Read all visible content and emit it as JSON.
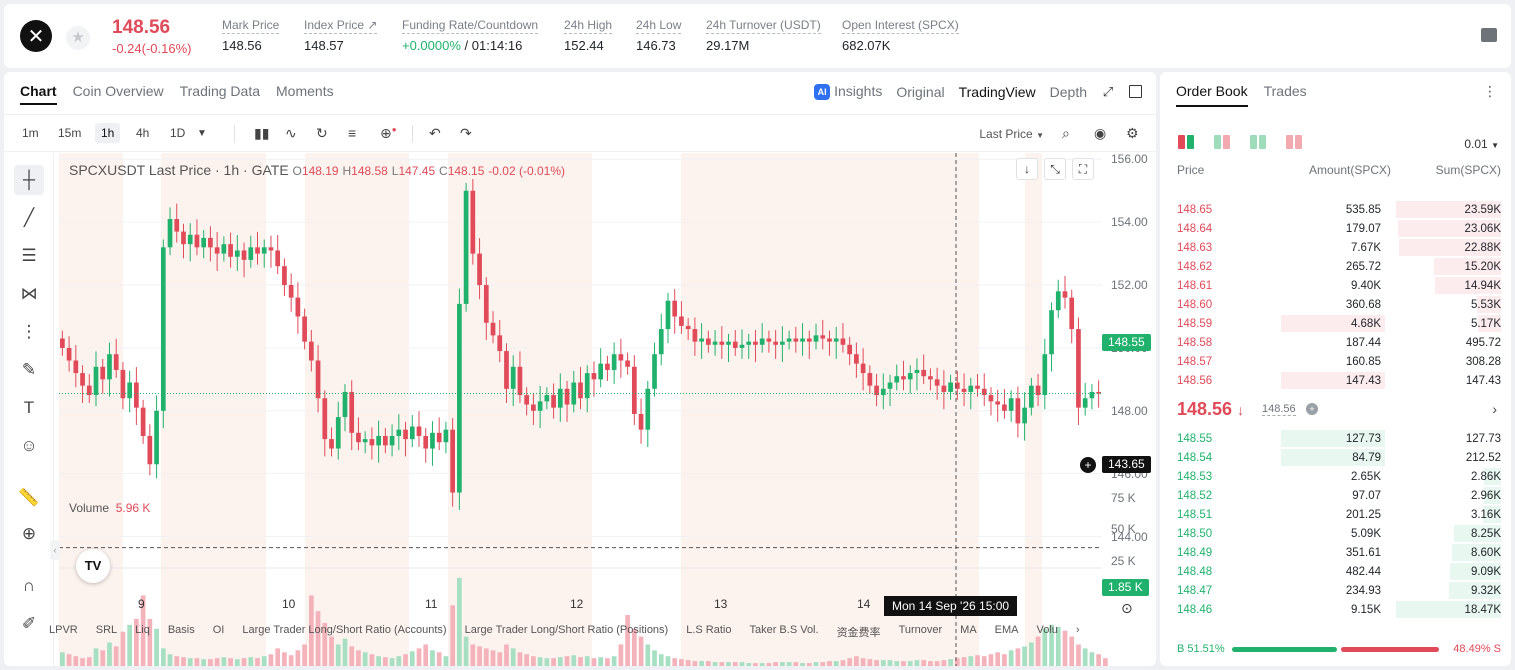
{
  "header": {
    "price": "148.56",
    "change": "-0.24(-0.16%)",
    "stats": [
      {
        "label": "Mark Price",
        "value": "148.56"
      },
      {
        "label": "Index Price ↗",
        "value": "148.57"
      },
      {
        "label": "Funding Rate/Countdown",
        "value_green": "+0.0000%",
        "value": " / 01:14:16"
      },
      {
        "label": "24h High",
        "value": "152.44"
      },
      {
        "label": "24h Low",
        "value": "146.73"
      },
      {
        "label": "24h Turnover (USDT)",
        "value": "29.17M"
      },
      {
        "label": "Open Interest (SPCX)",
        "value": "682.07K"
      }
    ]
  },
  "chart_tabs": [
    "Chart",
    "Coin Overview",
    "Trading Data",
    "Moments"
  ],
  "view_tabs": {
    "insights": "Insights",
    "original": "Original",
    "tradingview": "TradingView",
    "depth": "Depth"
  },
  "intervals": [
    "1m",
    "15m",
    "1h",
    "4h",
    "1D"
  ],
  "last_price_label": "Last Price",
  "legend": {
    "symbol": "SPCXUSDT Last Price · 1h · GATE",
    "o_label": "O",
    "o": "148.19",
    "h_label": "H",
    "h": "148.58",
    "l_label": "L",
    "l": "147.45",
    "c_label": "C",
    "c": "148.15",
    "change": "-0.02 (-0.01%)"
  },
  "volume_legend": {
    "label": "Volume",
    "value": "5.96 K"
  },
  "price_tags": {
    "current": "148.55",
    "crosshair": "143.65"
  },
  "crosshair_time": "Mon 14 Sep '26   15:00",
  "indicator_tabs": [
    "LPVR",
    "SRL",
    "Liq",
    "Basis",
    "OI",
    "Large Trader Long/Short Ratio (Accounts)",
    "Large Trader Long/Short Ratio (Positions)",
    "L.S Ratio",
    "Taker B.S Vol.",
    "资金费率",
    "Turnover",
    "MA",
    "EMA",
    "Volu"
  ],
  "chart_data": {
    "type": "candlestick",
    "title": "SPCXUSDT Last Price · 1h · GATE",
    "y_ticks": [
      "156.00",
      "154.00",
      "152.00",
      "150.00",
      "148.00",
      "146.00",
      "144.00"
    ],
    "x_ticks": [
      "9",
      "10",
      "11",
      "12",
      "13",
      "14"
    ],
    "ylim": [
      143.0,
      156.2
    ],
    "volume_ticks": [
      "75 K",
      "50 K",
      "25 K"
    ],
    "volume_current": "1.85 K",
    "volume_ylim": [
      0,
      100
    ],
    "current_price": 148.55,
    "crosshair_price": 143.65,
    "candles_close": [
      150.0,
      149.6,
      149.2,
      148.8,
      148.5,
      149.4,
      149.0,
      149.8,
      149.3,
      148.4,
      148.9,
      148.1,
      147.2,
      146.3,
      148.0,
      153.2,
      154.1,
      153.7,
      153.3,
      153.6,
      153.2,
      153.5,
      153.2,
      153.0,
      153.3,
      152.9,
      153.1,
      152.8,
      153.2,
      153.0,
      153.2,
      153.1,
      152.6,
      152.0,
      151.6,
      151.0,
      150.2,
      149.6,
      148.4,
      147.1,
      146.8,
      147.8,
      148.6,
      147.3,
      147.0,
      147.1,
      146.9,
      147.2,
      146.9,
      147.2,
      147.4,
      147.1,
      147.5,
      147.2,
      146.8,
      147.3,
      147.0,
      147.4,
      145.4,
      151.4,
      155.0,
      153.0,
      152.0,
      150.8,
      150.4,
      149.9,
      148.7,
      149.4,
      148.5,
      148.2,
      148.0,
      148.3,
      148.5,
      148.1,
      148.7,
      148.2,
      148.9,
      148.4,
      149.2,
      149.0,
      149.5,
      149.3,
      149.8,
      149.6,
      149.4,
      147.9,
      147.4,
      148.7,
      149.8,
      150.6,
      151.5,
      151.0,
      150.7,
      150.6,
      150.2,
      150.3,
      150.1,
      150.2,
      150.1,
      150.2,
      150.0,
      150.1,
      150.2,
      150.1,
      150.3,
      150.2,
      150.1,
      150.2,
      150.3,
      150.2,
      150.3,
      150.2,
      150.4,
      150.3,
      150.2,
      150.3,
      150.1,
      149.8,
      149.5,
      149.2,
      148.8,
      148.5,
      148.7,
      148.9,
      149.1,
      149.0,
      149.2,
      149.3,
      149.1,
      149.0,
      148.8,
      148.6,
      148.9,
      148.7,
      148.6,
      148.8,
      148.7,
      148.5,
      148.3,
      148.2,
      148.0,
      148.4,
      147.6,
      148.1,
      148.8,
      148.5,
      149.8,
      151.2,
      151.8,
      151.6,
      150.6,
      148.1,
      148.4,
      148.6,
      148.55
    ],
    "volumes": [
      14,
      12,
      10,
      8,
      9,
      18,
      16,
      24,
      20,
      35,
      42,
      48,
      72,
      48,
      38,
      18,
      12,
      10,
      9,
      8,
      8,
      7,
      7,
      8,
      9,
      8,
      7,
      8,
      9,
      8,
      10,
      12,
      18,
      14,
      11,
      16,
      22,
      72,
      56,
      44,
      30,
      22,
      28,
      20,
      16,
      14,
      12,
      10,
      9,
      8,
      10,
      12,
      15,
      18,
      22,
      16,
      14,
      10,
      62,
      90,
      30,
      22,
      20,
      18,
      16,
      14,
      22,
      18,
      14,
      12,
      10,
      9,
      8,
      8,
      9,
      10,
      11,
      9,
      10,
      8,
      9,
      8,
      10,
      22,
      52,
      38,
      30,
      22,
      16,
      12,
      10,
      8,
      7,
      6,
      5,
      5,
      5,
      4,
      4,
      4,
      4,
      4,
      3,
      3,
      3,
      3,
      4,
      4,
      4,
      4,
      3,
      3,
      4,
      4,
      5,
      5,
      6,
      8,
      10,
      8,
      7,
      6,
      6,
      6,
      5,
      5,
      5,
      6,
      6,
      5,
      5,
      6,
      7,
      8,
      9,
      10,
      11,
      10,
      12,
      14,
      12,
      16,
      18,
      20,
      24,
      30,
      38,
      42,
      40,
      36,
      30,
      22,
      18,
      14,
      12,
      8
    ]
  },
  "order_book": {
    "tabs": [
      "Order Book",
      "Trades"
    ],
    "precision": "0.01",
    "headers": {
      "price": "Price",
      "amount": "Amount(SPCX)",
      "sum": "Sum(SPCX)"
    },
    "asks": [
      {
        "price": "148.65",
        "amount": "535.85",
        "sum": "23.59K",
        "depth": 1.0,
        "amt_depth": 0
      },
      {
        "price": "148.64",
        "amount": "179.07",
        "sum": "23.06K",
        "depth": 0.98,
        "amt_depth": 0
      },
      {
        "price": "148.63",
        "amount": "7.67K",
        "sum": "22.88K",
        "depth": 0.97,
        "amt_depth": 0
      },
      {
        "price": "148.62",
        "amount": "265.72",
        "sum": "15.20K",
        "depth": 0.64,
        "amt_depth": 0
      },
      {
        "price": "148.61",
        "amount": "9.40K",
        "sum": "14.94K",
        "depth": 0.63,
        "amt_depth": 0
      },
      {
        "price": "148.60",
        "amount": "360.68",
        "sum": "5.53K",
        "depth": 0.23,
        "amt_depth": 0
      },
      {
        "price": "148.59",
        "amount": "4.68K",
        "sum": "5.17K",
        "depth": 0.22,
        "amt_depth": 1
      },
      {
        "price": "148.58",
        "amount": "187.44",
        "sum": "495.72",
        "depth": 0,
        "amt_depth": 0
      },
      {
        "price": "148.57",
        "amount": "160.85",
        "sum": "308.28",
        "depth": 0,
        "amt_depth": 0
      },
      {
        "price": "148.56",
        "amount": "147.43",
        "sum": "147.43",
        "depth": 0,
        "amt_depth": 1
      }
    ],
    "mid_price": "148.56",
    "mark_price": "148.56",
    "bids": [
      {
        "price": "148.55",
        "amount": "127.73",
        "sum": "127.73",
        "depth": 0,
        "amt_depth": 1
      },
      {
        "price": "148.54",
        "amount": "84.79",
        "sum": "212.52",
        "depth": 0,
        "amt_depth": 1
      },
      {
        "price": "148.53",
        "amount": "2.65K",
        "sum": "2.86K",
        "depth": 0.16,
        "amt_depth": 0
      },
      {
        "price": "148.52",
        "amount": "97.07",
        "sum": "2.96K",
        "depth": 0.16,
        "amt_depth": 0
      },
      {
        "price": "148.51",
        "amount": "201.25",
        "sum": "3.16K",
        "depth": 0.17,
        "amt_depth": 0
      },
      {
        "price": "148.50",
        "amount": "5.09K",
        "sum": "8.25K",
        "depth": 0.45,
        "amt_depth": 0
      },
      {
        "price": "148.49",
        "amount": "351.61",
        "sum": "8.60K",
        "depth": 0.47,
        "amt_depth": 0
      },
      {
        "price": "148.48",
        "amount": "482.44",
        "sum": "9.09K",
        "depth": 0.49,
        "amt_depth": 0
      },
      {
        "price": "148.47",
        "amount": "234.93",
        "sum": "9.32K",
        "depth": 0.5,
        "amt_depth": 0
      },
      {
        "price": "148.46",
        "amount": "9.15K",
        "sum": "18.47K",
        "depth": 1.0,
        "amt_depth": 0
      }
    ],
    "buy_ratio": "B 51.51%",
    "sell_ratio": "48.49% S",
    "buy_fraction": 0.5151
  },
  "colors": {
    "up": "#20b26c",
    "down": "#e04a59",
    "session_bg": "#fdf3ee"
  }
}
